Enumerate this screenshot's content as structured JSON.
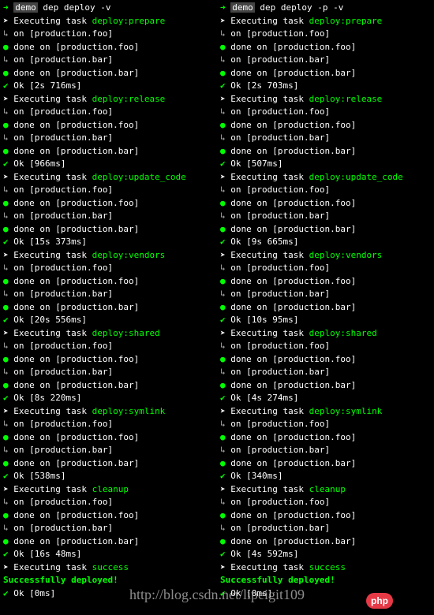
{
  "left": {
    "prompt": {
      "arrow": "➜",
      "name": "demo",
      "command": "dep deploy -v"
    },
    "glyphs": {
      "exec": "➤",
      "sub": "↳",
      "dot": "●",
      "check": "✔"
    },
    "labels": {
      "executing": "Executing task",
      "on": "on",
      "done_on": "done on",
      "ok": "Ok"
    },
    "hosts": {
      "foo": "[production.foo]",
      "bar": "[production.bar]"
    },
    "tasks": [
      {
        "name": "deploy:prepare",
        "time": "[2s 716ms]"
      },
      {
        "name": "deploy:release",
        "time": "[966ms]"
      },
      {
        "name": "deploy:update_code",
        "time": "[15s 373ms]"
      },
      {
        "name": "deploy:vendors",
        "time": "[20s 556ms]"
      },
      {
        "name": "deploy:shared",
        "time": "[8s 220ms]"
      },
      {
        "name": "deploy:symlink",
        "time": "[538ms]"
      },
      {
        "name": "cleanup",
        "time": "[16s 48ms]"
      },
      {
        "name": "success",
        "time": "[0ms]",
        "success": "Successfully deployed!"
      }
    ]
  },
  "right": {
    "prompt": {
      "arrow": "➜",
      "name": "demo",
      "command": "dep deploy -p -v"
    },
    "glyphs": {
      "exec": "➤",
      "sub": "↳",
      "dot": "●",
      "check": "✔"
    },
    "labels": {
      "executing": "Executing task",
      "on": "on",
      "done_on": "done on",
      "ok": "Ok"
    },
    "hosts": {
      "foo": "[production.foo]",
      "bar": "[production.bar]"
    },
    "tasks": [
      {
        "name": "deploy:prepare",
        "time": "[2s 703ms]"
      },
      {
        "name": "deploy:release",
        "time": "[507ms]"
      },
      {
        "name": "deploy:update_code",
        "time": "[9s 665ms]"
      },
      {
        "name": "deploy:vendors",
        "time": "[10s 95ms]"
      },
      {
        "name": "deploy:shared",
        "time": "[4s 274ms]"
      },
      {
        "name": "deploy:symlink",
        "time": "[340ms]"
      },
      {
        "name": "cleanup",
        "time": "[4s 592ms]"
      },
      {
        "name": "success",
        "time": "[0ms]",
        "success": "Successfully deployed!"
      }
    ]
  },
  "watermark": "http://blog.csdn.net/lipeigit109",
  "badge": "php"
}
